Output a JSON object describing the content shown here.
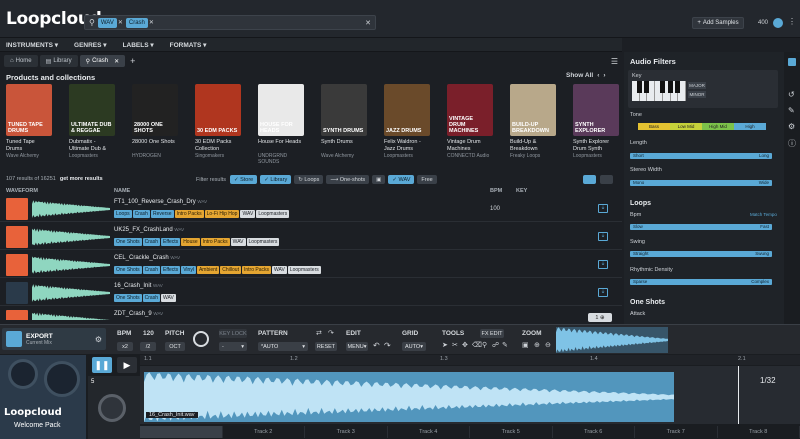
{
  "app": {
    "logo": "Loopcloud"
  },
  "search": {
    "tags": [
      "WAV",
      "Crash"
    ],
    "placeholder": ""
  },
  "header": {
    "add_samples": "Add Samples",
    "credits": "400"
  },
  "menu": [
    "INSTRUMENTS",
    "GENRES",
    "LABELS",
    "FORMATS"
  ],
  "tabs": [
    "Home",
    "Library",
    "Crash"
  ],
  "products": {
    "title": "Products and collections",
    "show_all": "Show All",
    "items": [
      {
        "title": "Tuned Tape Drums",
        "brand": "Wave Alchemy",
        "cover_text": "TUNED TAPE DRUMS",
        "color": "#c9553a"
      },
      {
        "title": "Dubmatix - Ultimate Dub & Reggae One Sh...",
        "brand": "Loopmasters",
        "cover_text": "ULTIMATE DUB & REGGAE",
        "color": "#2c3a22"
      },
      {
        "title": "28000 One Shots",
        "brand": "HYDROGEN",
        "cover_text": "28000 ONE SHOTS",
        "color": "#222"
      },
      {
        "title": "30 EDM Packs Collection",
        "brand": "Singomakers",
        "cover_text": "30 EDM PACKS",
        "color": "#b0361f"
      },
      {
        "title": "House For Heads",
        "brand": "UNDRGRND SOUNDS",
        "cover_text": "HOUSE FOR HEADS",
        "color": "#e9e9e9"
      },
      {
        "title": "Synth Drums",
        "brand": "Wave Alchemy",
        "cover_text": "SYNTH DRUMS",
        "color": "#3a3a3a"
      },
      {
        "title": "Felix Waldron - Jazz Drums",
        "brand": "Loopmasters",
        "cover_text": "JAZZ DRUMS",
        "color": "#6a4a2a"
      },
      {
        "title": "Vintage Drum Machines",
        "brand": "CONNECTD Audio",
        "cover_text": "VINTAGE DRUM MACHINES",
        "color": "#7a1f2a"
      },
      {
        "title": "Build-Up & Breakdown Collection",
        "brand": "Freaky Loops",
        "cover_text": "BUILD-UP BREAKDOWN",
        "color": "#b8a88a"
      },
      {
        "title": "Synth Explorer Drum Synth Drums",
        "brand": "Loopmasters",
        "cover_text": "SYNTH EXPLORER",
        "color": "#5a3a5a"
      }
    ]
  },
  "results": {
    "count": "107 results of 16251",
    "more": "get more results",
    "filter_label": "Filter results",
    "filters": [
      "Store",
      "Library",
      "Loops",
      "One-shots",
      "",
      "WAV",
      "Free"
    ],
    "columns": {
      "waveform": "WAVEFORM",
      "name": "NAME",
      "bpm": "BPM",
      "key": "KEY"
    },
    "rows": [
      {
        "name": "FT1_100_Reverse_Crash_Dry",
        "fmt": "WAV",
        "bpm": "100",
        "key": "",
        "tags": [
          [
            "Loops",
            "b"
          ],
          [
            "Crash",
            "b"
          ],
          [
            "Reverse",
            "b"
          ],
          [
            "Intro Packs",
            "o"
          ],
          [
            "Lo-Fi Hip Hop",
            "o"
          ],
          [
            "WAV",
            "w"
          ],
          [
            "Loopmasters",
            "w"
          ]
        ]
      },
      {
        "name": "UK25_FX_CrashLand",
        "fmt": "WAV",
        "bpm": "",
        "key": "",
        "tags": [
          [
            "One Shots",
            "b"
          ],
          [
            "Crash",
            "b"
          ],
          [
            "Effects",
            "b"
          ],
          [
            "House",
            "o"
          ],
          [
            "Intro Packs",
            "o"
          ],
          [
            "WAV",
            "w"
          ],
          [
            "Loopmasters",
            "w"
          ]
        ]
      },
      {
        "name": "CEL_Crackle_Crash",
        "fmt": "WAV",
        "bpm": "",
        "key": "",
        "tags": [
          [
            "One Shots",
            "b"
          ],
          [
            "Crash",
            "b"
          ],
          [
            "Effects",
            "b"
          ],
          [
            "Vinyl",
            "b"
          ],
          [
            "Ambient",
            "o"
          ],
          [
            "Chillout",
            "o"
          ],
          [
            "Intro Packs",
            "o"
          ],
          [
            "WAV",
            "w"
          ],
          [
            "Loopmasters",
            "w"
          ]
        ]
      },
      {
        "name": "16_Crash_Init",
        "fmt": "WAV",
        "bpm": "",
        "key": "",
        "tags": [
          [
            "One Shots",
            "b"
          ],
          [
            "Crash",
            "b"
          ],
          [
            "WAV",
            "w"
          ]
        ]
      },
      {
        "name": "ZDT_Crash_9",
        "fmt": "WAV",
        "bpm": "",
        "key": "",
        "tags": []
      }
    ]
  },
  "filters_panel": {
    "title": "Audio Filters",
    "key_label": "Key",
    "major": "MAJOR",
    "minor": "MINOR",
    "tone": "Tone",
    "tone_labels": [
      "Bass",
      "Low Mid",
      "High Mid",
      "High"
    ],
    "length": "Length",
    "length_range": [
      "Short",
      "Long"
    ],
    "stereo": "Stereo Width",
    "stereo_range": [
      "Mono",
      "Wide"
    ],
    "loops": "Loops",
    "bpm": "Bpm",
    "match_tempo": "Match Tempo",
    "bpm_range": [
      "Slow",
      "Fast"
    ],
    "swing": "Swing",
    "swing_range": [
      "Straight",
      "Swung"
    ],
    "rhythmic": "Rhythmic Density",
    "rhythmic_range": [
      "Sparse",
      "Complex"
    ],
    "one_shots": "One Shots",
    "attack": "Attack"
  },
  "player": {
    "export": "EXPORT",
    "current_mix": "Current Mix",
    "bpm_label": "BPM",
    "bpm_value": "120",
    "bpm_half": "x2",
    "bpm_double": "/2",
    "pitch_label": "PITCH",
    "pitch_oct": "OCT",
    "key_lock": "KEY LOCK",
    "pattern_label": "PATTERN",
    "pattern_value": "*AUTO",
    "reset": "RESET",
    "edit_label": "EDIT",
    "edit_menu": "MENU",
    "grid_label": "GRID",
    "grid_value": "AUTO",
    "tools_label": "TOOLS",
    "fx_edit": "FX EDIT",
    "zoom_label": "ZOOM",
    "welcome": "Welcome Pack",
    "ruler": [
      "1.1",
      "1.2",
      "1.3",
      "1.4",
      "2.1"
    ],
    "loop_len": "1/32",
    "clip_name": "16_Crash_Init.wav",
    "track_num": "5",
    "tracks": [
      "",
      "Track 2",
      "Track 3",
      "Track 4",
      "Track 5",
      "Track 6",
      "Track 7",
      "Track 8"
    ]
  },
  "colors": {
    "accent": "#5aa9d6",
    "orange": "#e4a531",
    "bg": "#1c1f24"
  }
}
